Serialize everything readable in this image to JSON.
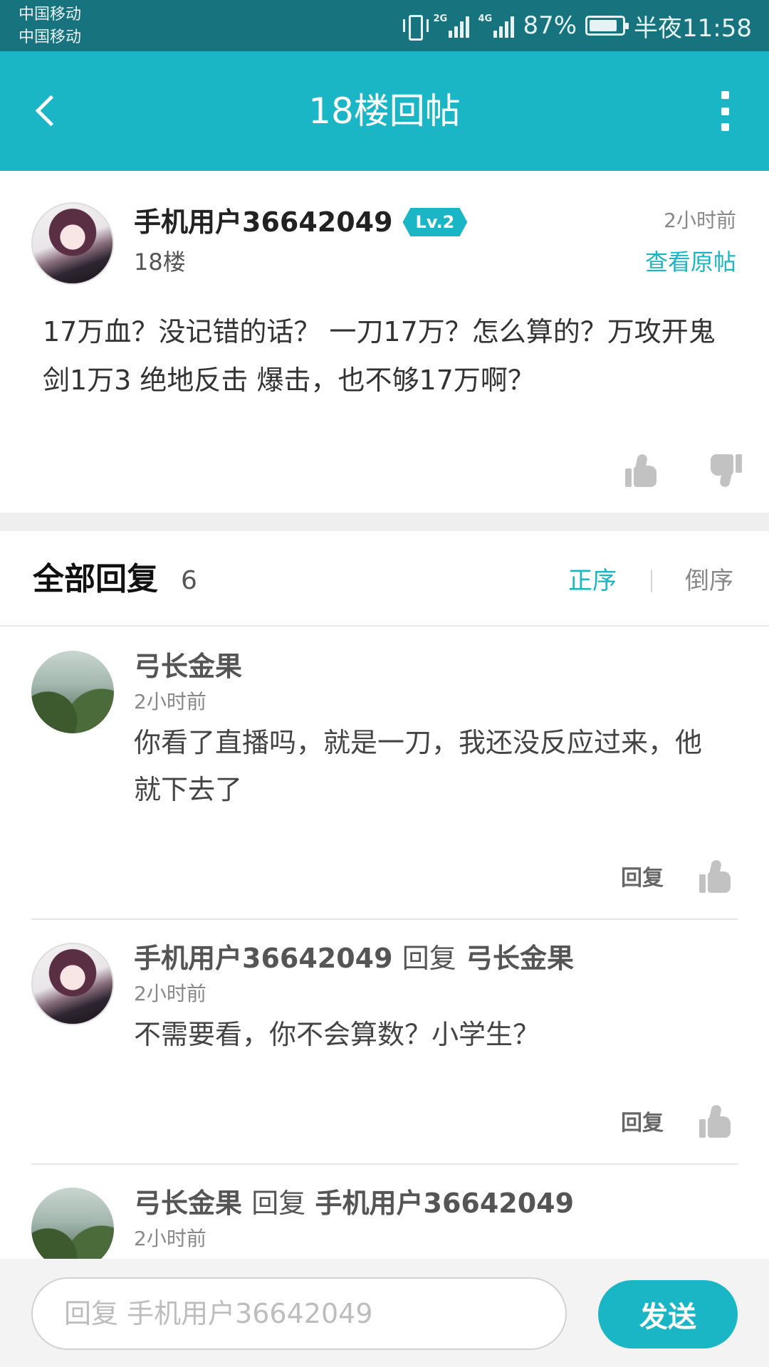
{
  "status_bar": {
    "carrier1": "中国移动",
    "carrier2": "中国移动",
    "net1": "2G",
    "net2": "4G",
    "battery": "87%",
    "battery_level": 0.87,
    "time": "半夜11:58"
  },
  "header": {
    "title": "18楼回帖",
    "back_icon": "chevron-left-icon",
    "more_icon": "more-vertical-icon"
  },
  "post": {
    "author": "手机用户36642049",
    "level": "Lv.2",
    "floor": "18楼",
    "time": "2小时前",
    "view_original": "查看原帖",
    "content": "17万血？没记错的话？ 一刀17万？怎么算的？万攻开鬼剑1万3  绝地反击 爆击，也不够17万啊？"
  },
  "replies_header": {
    "title": "全部回复",
    "count": "6",
    "sort_asc": "正序",
    "sort_desc": "倒序"
  },
  "replies": [
    {
      "author": "弓长金果",
      "time": "2小时前",
      "text": "你看了直播吗，就是一刀，我还没反应过来，他就下去了",
      "reply_label": "回复"
    },
    {
      "author": "手机用户36642049",
      "verb": "回复",
      "target": "弓长金果",
      "time": "2小时前",
      "text": "不需要看，你不会算数？小学生？",
      "reply_label": "回复"
    },
    {
      "author": "弓长金果",
      "verb": "回复",
      "target": "手机用户36642049",
      "time": "2小时前"
    }
  ],
  "composer": {
    "placeholder": "回复 手机用户36642049",
    "send_label": "发送"
  },
  "colors": {
    "accent": "#1ab6c6",
    "status_bar": "#17737e"
  }
}
